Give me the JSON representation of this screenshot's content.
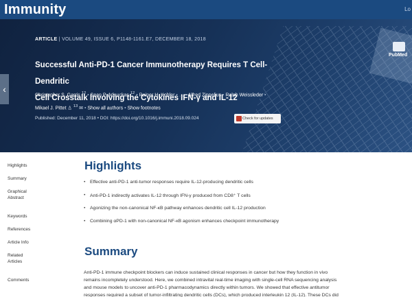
{
  "header": {
    "brand": "Immunity",
    "top_right": "Lo"
  },
  "article": {
    "label": "ARTICLE",
    "meta": "VOLUME 49, ISSUE 6, P1148-1161.E7, DECEMBER 18, 2018",
    "title_line1": "Successful Anti-PD-1 Cancer Immunotherapy Requires T Cell-Dendritic",
    "title_line2": "Cell Crosstalk Involving the Cytokines IFN-γ and IL-12",
    "authors": {
      "a1": "Christopher S. Garris",
      "a1_sup": "12",
      "a2": "Sean P. Arlauckas",
      "a2_sup": "12",
      "a3": "Rainer H. Kohler",
      "a4": "Alfred Zippelius",
      "a5": "Ralph Weissleder",
      "a6": "Mikael J. Pittet",
      "a6_sup": "13",
      "show_authors": "Show all authors",
      "show_footnotes": "Show footnotes"
    },
    "published": "Published: December 11, 2018",
    "doi": "DOI: https://doi.org/10.1016/j.immuni.2018.09.024",
    "check_updates": "Check for updates",
    "pubmed": "PubMed"
  },
  "sidebar": {
    "items": [
      "Highlights",
      "Summary",
      "Graphical Abstract",
      "Keywords",
      "References",
      "Article Info",
      "Related Articles",
      "Comments"
    ]
  },
  "highlights": {
    "heading": "Highlights",
    "items": [
      "Effective anti-PD-1 anti-tumor responses require IL-12-producing dendritic cells",
      "Anti-PD-1 indirectly activates IL-12 through IFN-γ produced from CD8⁺ T cells",
      "Agonizing the non-canonical NF-κB pathway enhances dendritic cell IL-12 production",
      "Combining αPD-1 with non-canonical NF-κB agonism enhances checkpoint immunotherapy"
    ]
  },
  "summary": {
    "heading": "Summary",
    "line1": "Anti-PD-1 immune checkpoint blockers can induce sustained clinical responses in cancer but how they function in vivo",
    "line2": "remains incompletely understood. Here, we combined intravital real-time imaging with single-cell RNA sequencing analysis",
    "line3": "and mouse models to uncover anti-PD-1 pharmacodynamics directly within tumors. We showed that effective antitumor",
    "line4": "responses required a subset of tumor-infiltrating dendritic cells (DCs), which produced interleukin 12 (IL-12). These DCs did"
  }
}
